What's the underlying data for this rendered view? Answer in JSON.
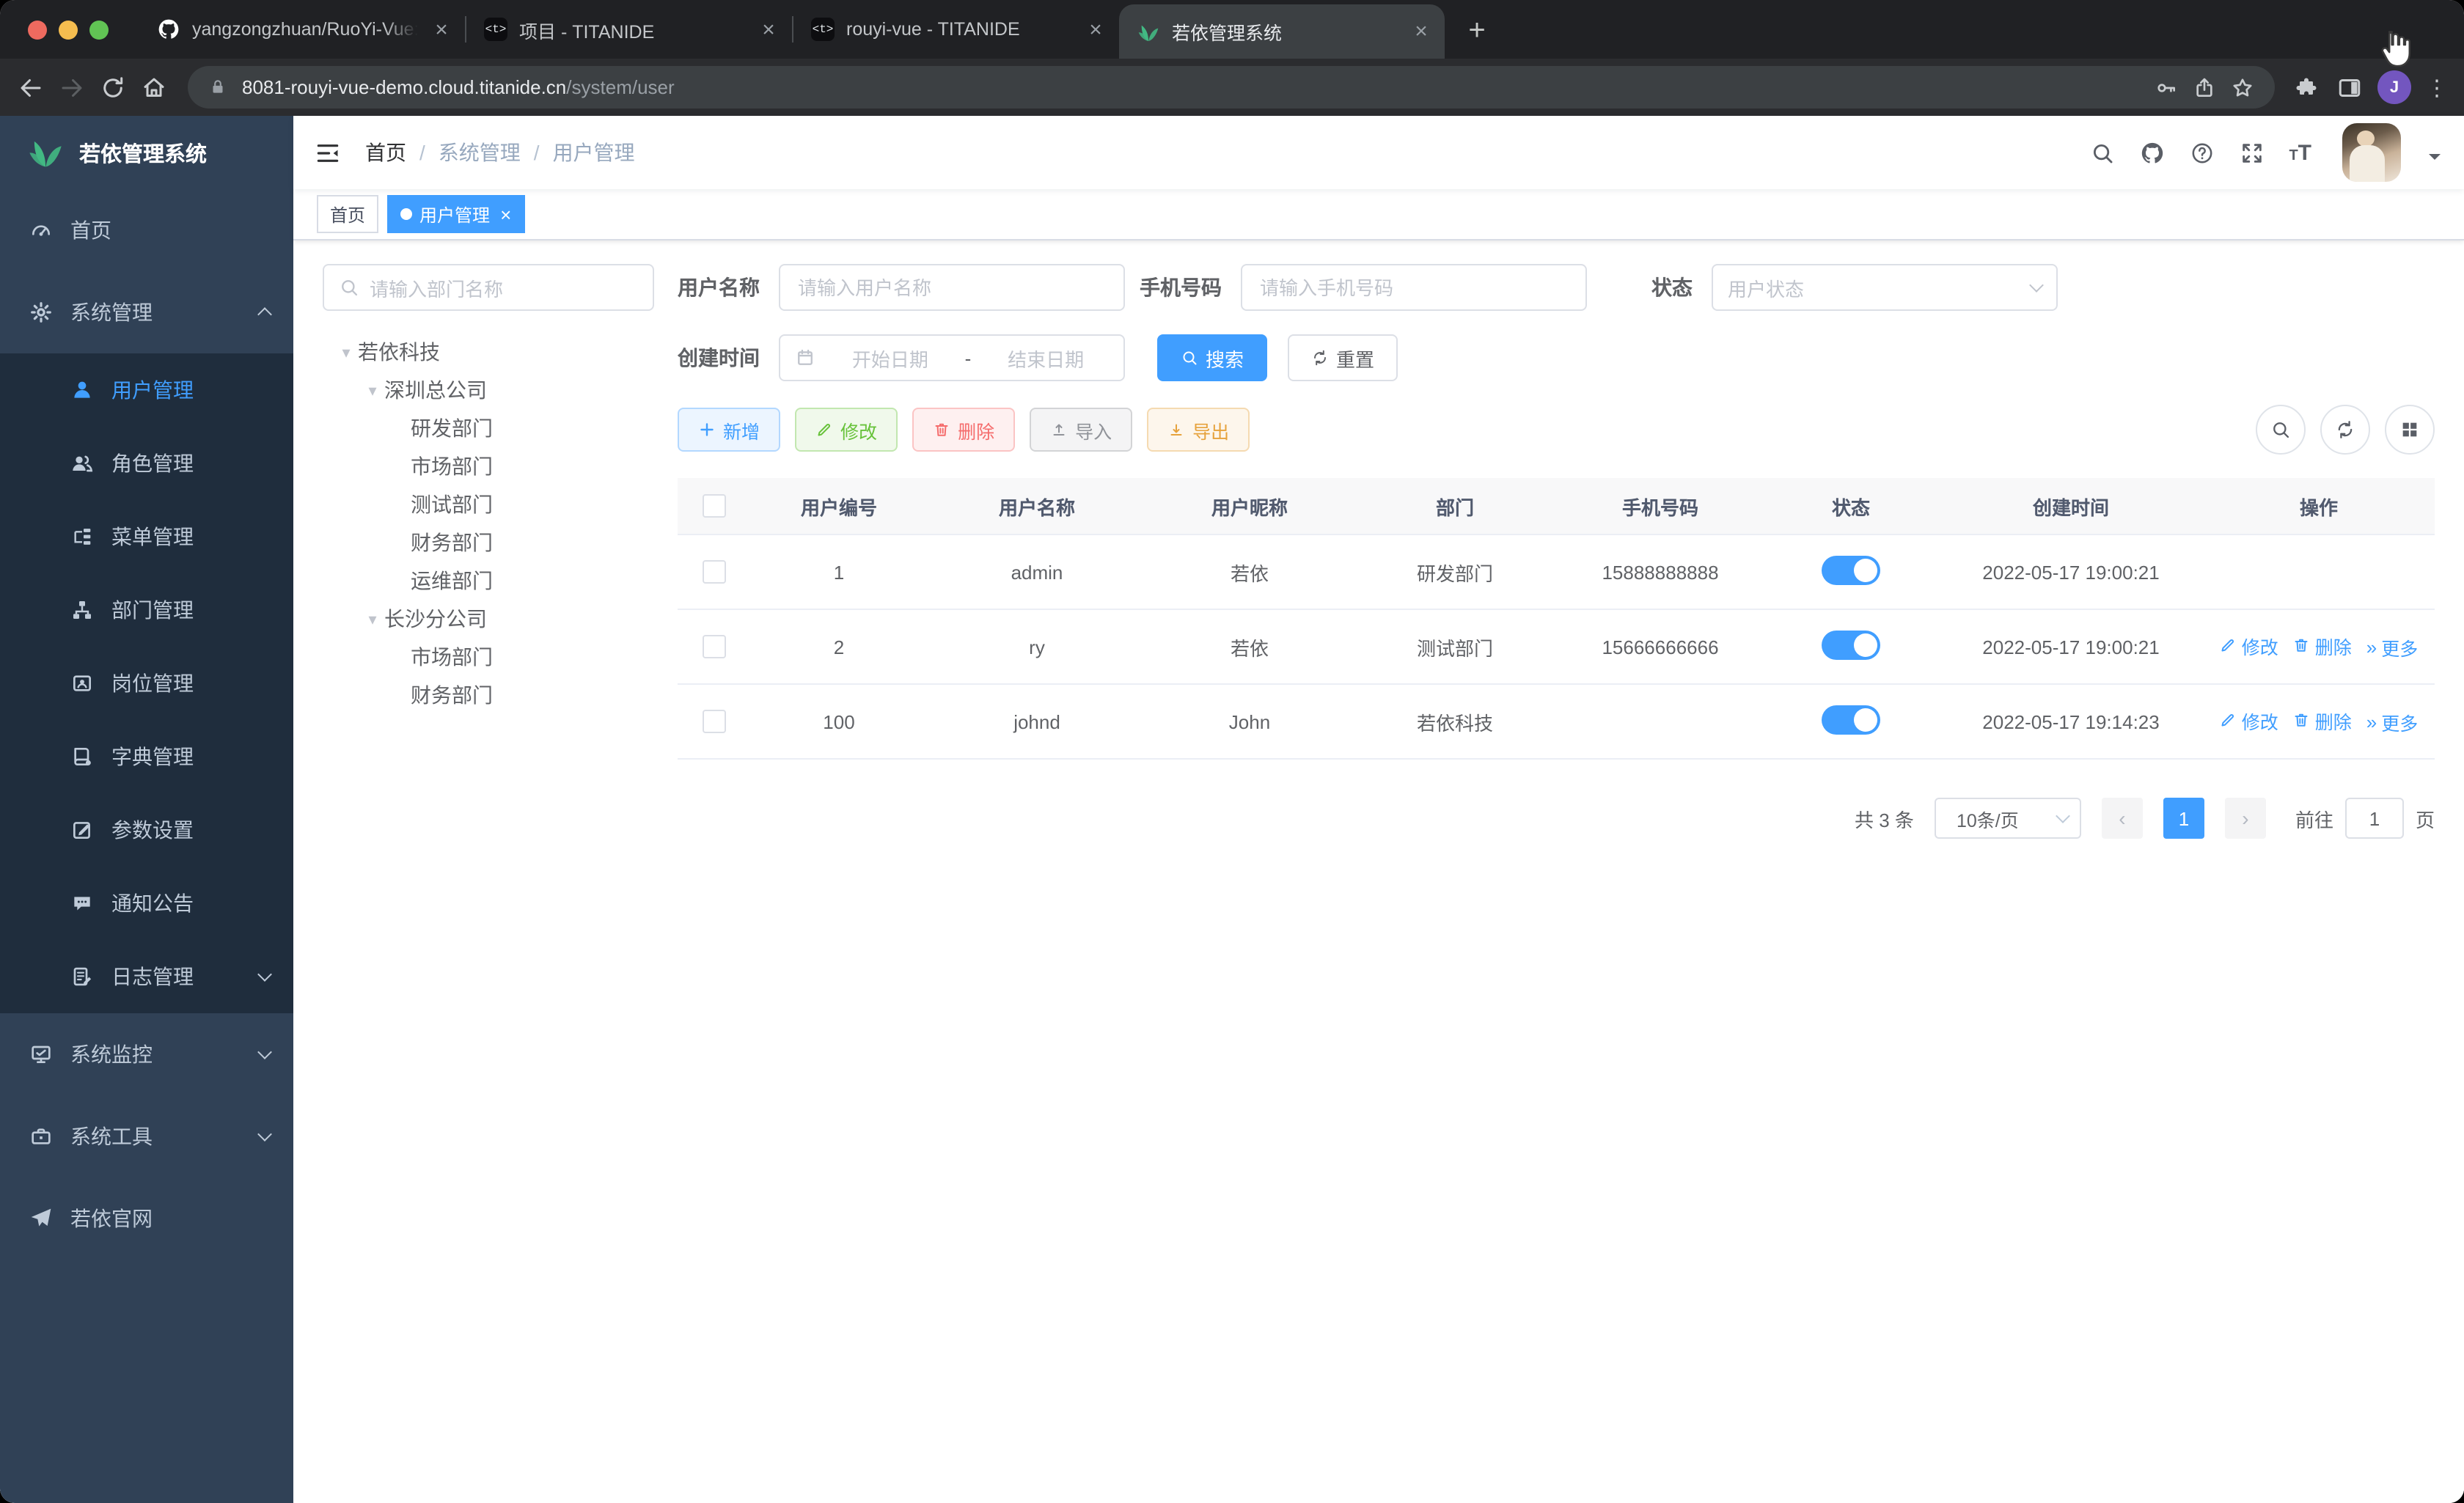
{
  "glyphs": {
    "close": "×",
    "plus": "+",
    "dots": "⋮",
    "caret_down": "▾",
    "more": "»",
    "dash": "-"
  },
  "browser": {
    "tabs": [
      {
        "name": "tab-github-ruoyi",
        "title": "yangzongzhuan/RuoYi-Vue: (R",
        "icon": "github",
        "active": false
      },
      {
        "name": "tab-project-titanide",
        "title": "项目 - TITANIDE",
        "icon": "code",
        "active": false
      },
      {
        "name": "tab-rouyi-vue-titanide",
        "title": "rouyi-vue - TITANIDE",
        "icon": "code",
        "active": false
      },
      {
        "name": "tab-ruoyi-admin",
        "title": "若依管理系统",
        "icon": "leaf",
        "active": true
      }
    ],
    "url_host": "8081-rouyi-vue-demo.cloud.titanide.cn",
    "url_path": "/system/user",
    "profile_initial": "J",
    "code_favicon_text": "<t>"
  },
  "sidebar": {
    "logo_title": "若依管理系统",
    "items": [
      {
        "name": "sidebar-item-home",
        "label": "首页",
        "icon": "gauge",
        "indent": false
      },
      {
        "name": "sidebar-item-system-management",
        "label": "系统管理",
        "icon": "gear",
        "indent": false,
        "chevron": "up"
      },
      {
        "name": "sidebar-item-user-management",
        "label": "用户管理",
        "icon": "user",
        "indent": true,
        "active": true
      },
      {
        "name": "sidebar-item-role-management",
        "label": "角色管理",
        "icon": "users",
        "indent": true
      },
      {
        "name": "sidebar-item-menu-management",
        "label": "菜单管理",
        "icon": "menu",
        "indent": true
      },
      {
        "name": "sidebar-item-dept-management",
        "label": "部门管理",
        "icon": "dept",
        "indent": true
      },
      {
        "name": "sidebar-item-post-management",
        "label": "岗位管理",
        "icon": "post",
        "indent": true
      },
      {
        "name": "sidebar-item-dict-management",
        "label": "字典管理",
        "icon": "dict",
        "indent": true
      },
      {
        "name": "sidebar-item-param-settings",
        "label": "参数设置",
        "icon": "edit",
        "indent": true
      },
      {
        "name": "sidebar-item-notice",
        "label": "通知公告",
        "icon": "msg",
        "indent": true
      },
      {
        "name": "sidebar-item-log-management",
        "label": "日志管理",
        "icon": "log",
        "indent": true,
        "chevron": "down"
      },
      {
        "name": "sidebar-item-system-monitor",
        "label": "系统监控",
        "icon": "monitor",
        "indent": false,
        "chevron": "down"
      },
      {
        "name": "sidebar-item-system-tools",
        "label": "系统工具",
        "icon": "tool",
        "indent": false,
        "chevron": "down"
      },
      {
        "name": "sidebar-item-ruoyi-website",
        "label": "若依官网",
        "icon": "plane",
        "indent": false
      }
    ]
  },
  "header": {
    "breadcrumb": [
      "首页",
      "系统管理",
      "用户管理"
    ],
    "separator": "/"
  },
  "tags": [
    {
      "label": "首页",
      "active": false,
      "closable": false
    },
    {
      "label": "用户管理",
      "active": true,
      "closable": true
    }
  ],
  "dept_tree": {
    "search_placeholder": "请输入部门名称",
    "nodes": [
      {
        "label": "若依科技",
        "level": 0,
        "expanded": true
      },
      {
        "label": "深圳总公司",
        "level": 1,
        "expanded": true
      },
      {
        "label": "研发部门",
        "level": 2
      },
      {
        "label": "市场部门",
        "level": 2
      },
      {
        "label": "测试部门",
        "level": 2
      },
      {
        "label": "财务部门",
        "level": 2
      },
      {
        "label": "运维部门",
        "level": 2
      },
      {
        "label": "长沙分公司",
        "level": 1,
        "expanded": true
      },
      {
        "label": "市场部门",
        "level": 2
      },
      {
        "label": "财务部门",
        "level": 2
      }
    ]
  },
  "filters": {
    "username_label": "用户名称",
    "username_placeholder": "请输入用户名称",
    "phone_label": "手机号码",
    "phone_placeholder": "请输入手机号码",
    "status_label": "状态",
    "status_placeholder": "用户状态",
    "created_label": "创建时间",
    "date_start_placeholder": "开始日期",
    "date_separator": "-",
    "date_end_placeholder": "结束日期",
    "search_button": "搜索",
    "reset_button": "重置"
  },
  "toolbar": {
    "buttons": [
      {
        "name": "add-button",
        "label": "新增",
        "kind": "primary",
        "icon": "plus"
      },
      {
        "name": "edit-button",
        "label": "修改",
        "kind": "success",
        "icon": "pencil"
      },
      {
        "name": "delete-button",
        "label": "删除",
        "kind": "danger",
        "icon": "trash"
      },
      {
        "name": "import-button",
        "label": "导入",
        "kind": "info",
        "icon": "upload"
      },
      {
        "name": "export-button",
        "label": "导出",
        "kind": "warning",
        "icon": "download"
      }
    ]
  },
  "table": {
    "headers": [
      "用户编号",
      "用户名称",
      "用户昵称",
      "部门",
      "手机号码",
      "状态",
      "创建时间",
      "操作"
    ],
    "rows": [
      {
        "id": "1",
        "username": "admin",
        "nickname": "若依",
        "dept": "研发部门",
        "phone": "15888888888",
        "status_on": true,
        "created": "2022-05-17 19:00:21",
        "show_actions": false
      },
      {
        "id": "2",
        "username": "ry",
        "nickname": "若依",
        "dept": "测试部门",
        "phone": "15666666666",
        "status_on": true,
        "created": "2022-05-17 19:00:21",
        "show_actions": true
      },
      {
        "id": "100",
        "username": "johnd",
        "nickname": "John",
        "dept": "若依科技",
        "phone": "",
        "status_on": true,
        "created": "2022-05-17 19:14:23",
        "show_actions": true
      }
    ],
    "row_actions": [
      {
        "name": "row-edit-link",
        "label": "修改",
        "icon": "pencil"
      },
      {
        "name": "row-delete-link",
        "label": "删除",
        "icon": "trash"
      },
      {
        "name": "row-more-link",
        "label": "更多",
        "icon": "more"
      }
    ]
  },
  "pagination": {
    "total": "共 3 条",
    "page_size": "10条/页",
    "prev_glyph": "‹",
    "next_glyph": "›",
    "current_page": "1",
    "goto_label": "前往",
    "goto_value": "1",
    "page_unit": "页"
  },
  "colors": {
    "accent": "#409eff",
    "sidebar": "#304156",
    "sidebar_submenu": "#1f2d3d",
    "success": "#67c23a",
    "danger": "#f56c6c",
    "warning": "#e6a23c",
    "info": "#909399",
    "tag_active": "#409eff"
  }
}
